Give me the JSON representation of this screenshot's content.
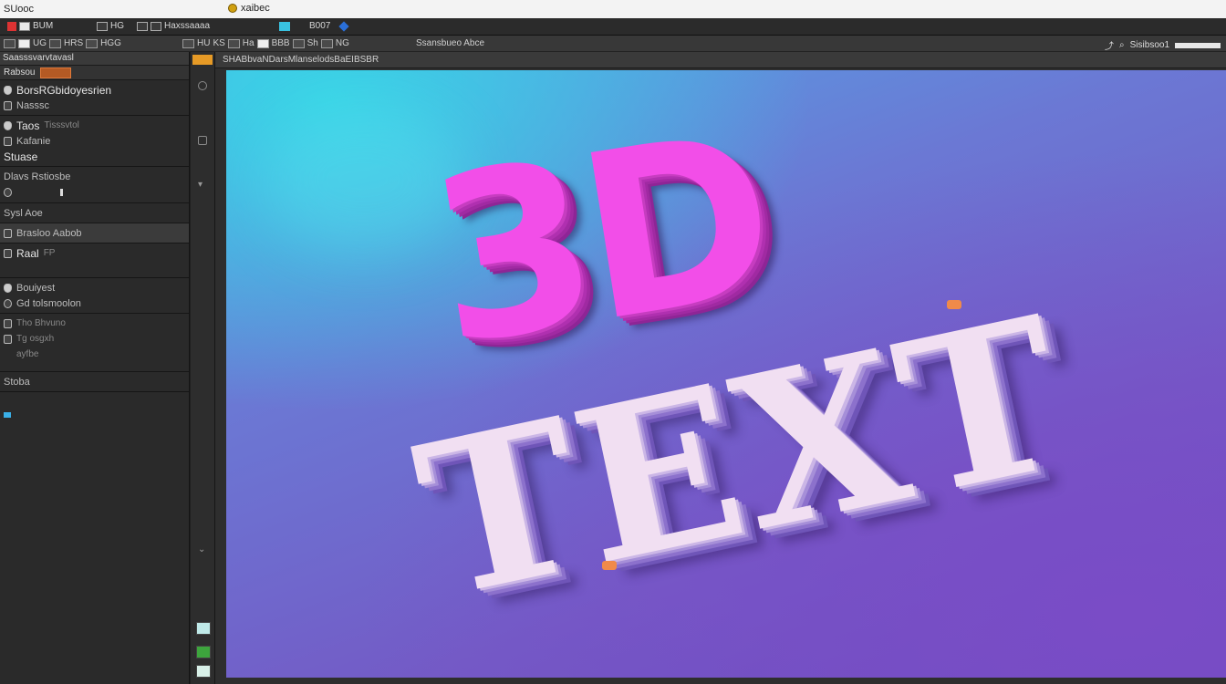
{
  "window": {
    "title_left": "SUooc",
    "title_mid": "xaibec"
  },
  "menubar": {
    "items": [
      {
        "label": "BUM",
        "icon": "red-app-icon"
      },
      {
        "label": "HG",
        "icon": "layers-icon"
      },
      {
        "label": "Haxssaaaa",
        "icon": "file-icon"
      },
      {
        "label": "B007",
        "icon": "cyan-tool-icon"
      }
    ]
  },
  "optbar": {
    "items": [
      "UG",
      "HRS",
      "HGG",
      "HU",
      "KS",
      "Ha",
      "BBB",
      "Sh",
      "NG"
    ],
    "caption": "Ssansbueo Abce",
    "right_label": "Sisibsoo1"
  },
  "leftpanel": {
    "header": "Saasssvarvtavasl",
    "tab_label": "Rabsou",
    "sections": [
      {
        "rows": [
          {
            "label": "BorsRGbidoyesrien"
          },
          {
            "label": "Nasssc",
            "sub": true
          }
        ]
      },
      {
        "rows": [
          {
            "label": "Taos",
            "dim": "Tisssvtol"
          },
          {
            "label": "Kafanie",
            "sub": true
          }
        ],
        "footer": "Stuase"
      },
      {
        "rows": [
          {
            "label": "Dlavs Rstiosbe"
          }
        ]
      },
      {
        "rows": [
          {
            "label": "Sysl Aoe"
          }
        ]
      },
      {
        "rows": [
          {
            "label": "Brasloo Aabob"
          }
        ],
        "selected": true
      },
      {
        "rows": [
          {
            "label": "Raal",
            "dim": "FP"
          }
        ]
      },
      {
        "rows": [
          {
            "label": "Bouiyest"
          },
          {
            "label": "Gd tolsmoolon"
          }
        ]
      },
      {
        "rows": [
          {
            "label": "Tho Bhvuno"
          },
          {
            "label": "Tg osgxh"
          },
          {
            "label": "ayfbe"
          }
        ]
      },
      {
        "rows": [
          {
            "label": "Stoba"
          }
        ]
      }
    ]
  },
  "canvas": {
    "tab_title": "SHABbvaNDarsMlanselodsBaEIBSBR",
    "line1": "3D",
    "line2": "TEXT"
  },
  "colors": {
    "accent_orange": "#e69a26",
    "text_magenta": "#f24ee8",
    "bg_cyan": "#39d4e6",
    "bg_purple": "#735bc6"
  }
}
